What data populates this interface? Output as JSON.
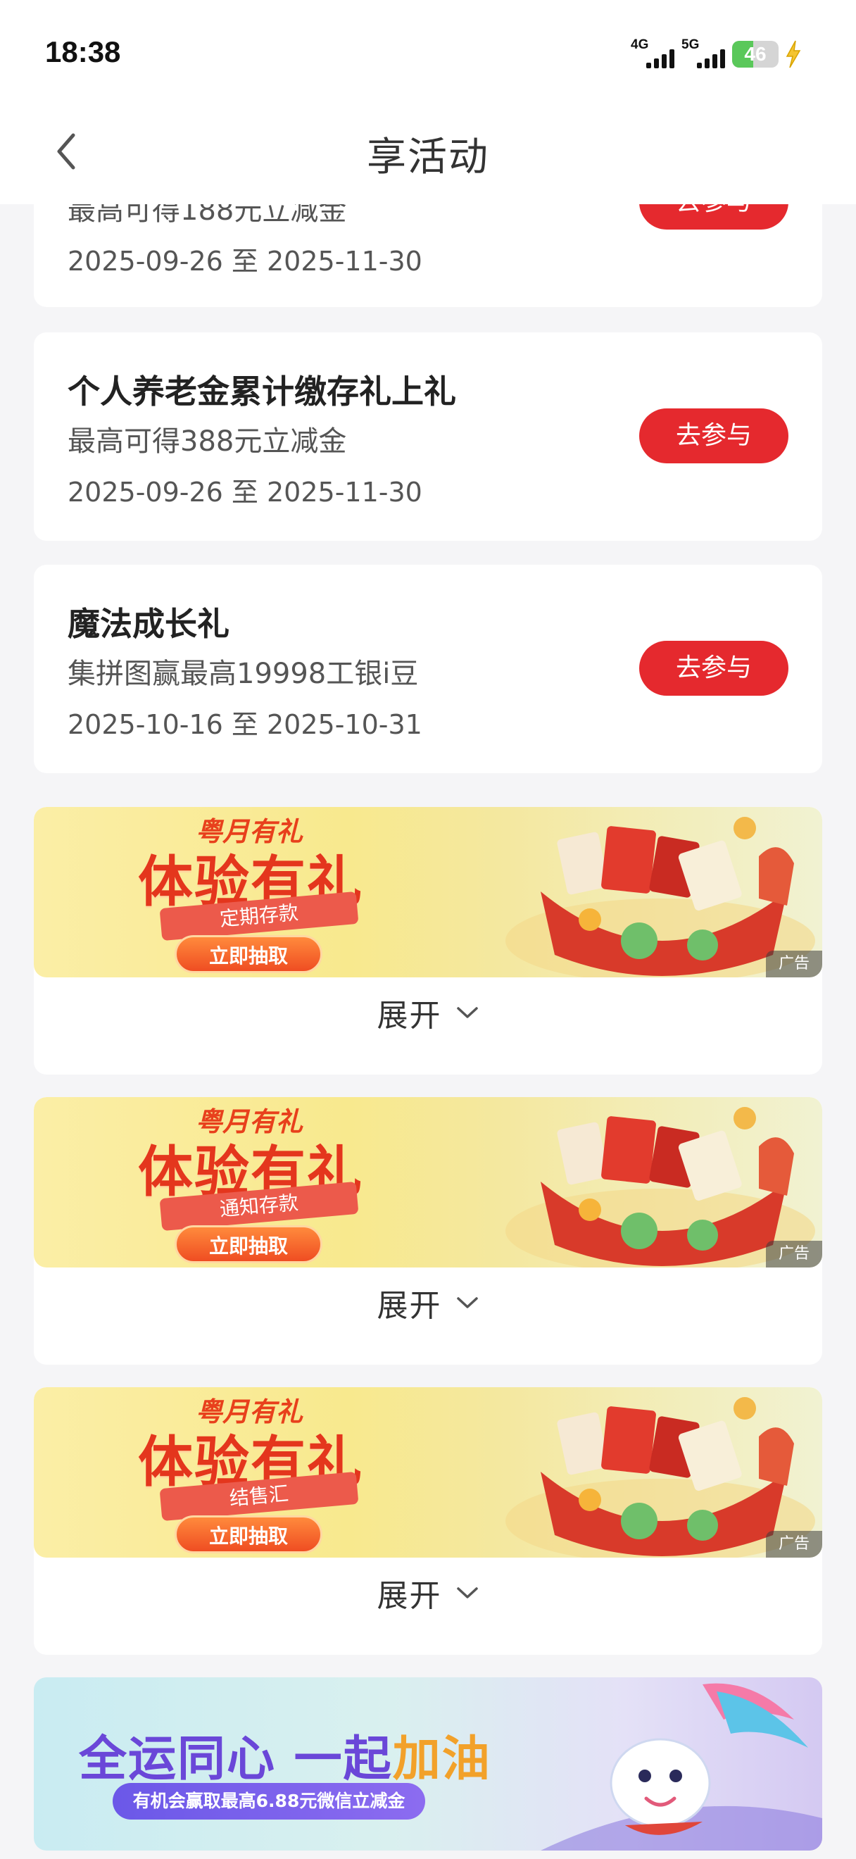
{
  "status_bar": {
    "time": "18:38",
    "net1": "4G",
    "net2": "5G",
    "battery": "46",
    "battery_level": 0.46
  },
  "header": {
    "title": "享活动"
  },
  "activities": [
    {
      "title": "",
      "subtitle": "最高可得188元立减金",
      "date": "2025-09-26 至 2025-11-30",
      "button": "去参与"
    },
    {
      "title": "个人养老金累计缴存礼上礼",
      "subtitle": "最高可得388元立减金",
      "date": "2025-09-26 至 2025-11-30",
      "button": "去参与"
    },
    {
      "title": "魔法成长礼",
      "subtitle": "集拼图赢最高19998工银i豆",
      "date": "2025-10-16 至 2025-10-31",
      "button": "去参与"
    }
  ],
  "promos": [
    {
      "brand": "粤月有礼",
      "headline": "体验有礼",
      "ribbon": "定期存款",
      "cta": "立即抽取",
      "ad": "广告",
      "expand": "展开"
    },
    {
      "brand": "粤月有礼",
      "headline": "体验有礼",
      "ribbon": "通知存款",
      "cta": "立即抽取",
      "ad": "广告",
      "expand": "展开"
    },
    {
      "brand": "粤月有礼",
      "headline": "体验有礼",
      "ribbon": "结售汇",
      "cta": "立即抽取",
      "ad": "广告",
      "expand": "展开"
    }
  ],
  "games_banner": {
    "headline_a": "全运同心 一起",
    "headline_b": "加油",
    "pill": "有机会赢取最高6.88元微信立减金"
  },
  "colors": {
    "accent": "#e5292e",
    "background": "#f5f5f7"
  }
}
